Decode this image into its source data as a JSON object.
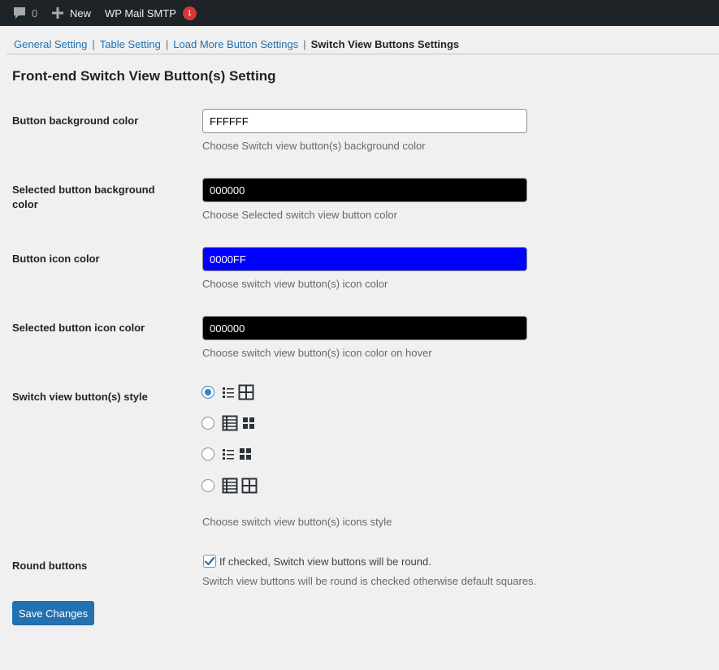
{
  "adminbar": {
    "comments_count": "0",
    "new_label": "New",
    "smtp_label": "WP Mail SMTP",
    "smtp_badge": "1"
  },
  "nav": {
    "tabs": [
      {
        "label": "General Setting"
      },
      {
        "label": "Table Setting"
      },
      {
        "label": "Load More Button Settings"
      },
      {
        "label": "Switch View Buttons Settings",
        "current": true
      }
    ],
    "separator": "|"
  },
  "page": {
    "heading": "Front-end Switch View Button(s) Setting"
  },
  "fields": {
    "button_bg": {
      "label": "Button background color",
      "value": "FFFFFF",
      "bg_color": "#FFFFFF",
      "text_color": "#000000",
      "description": "Choose Switch view button(s) background color"
    },
    "selected_button_bg": {
      "label": "Selected button background color",
      "value": "000000",
      "bg_color": "#000000",
      "text_color": "#FFFFFF",
      "description": "Choose Selected switch view button color"
    },
    "button_icon": {
      "label": "Button icon color",
      "value": "0000FF",
      "bg_color": "#0000FF",
      "text_color": "#FFFFFF",
      "description": "Choose switch view button(s) icon color"
    },
    "selected_button_icon": {
      "label": "Selected button icon color",
      "value": "000000",
      "bg_color": "#000000",
      "text_color": "#FFFFFF",
      "description": "Choose switch view button(s) icon color on hover"
    },
    "style": {
      "label": "Switch view button(s) style",
      "options": [
        {
          "icons": [
            "list-dots-icon",
            "grid-outline-icon"
          ],
          "checked": true
        },
        {
          "icons": [
            "list-table-icon",
            "grid-filled-icon"
          ],
          "checked": false
        },
        {
          "icons": [
            "list-dots-icon",
            "grid-filled-icon"
          ],
          "checked": false
        },
        {
          "icons": [
            "list-table-icon",
            "grid-outline-icon"
          ],
          "checked": false
        }
      ],
      "description": "Choose switch view button(s) icons style"
    },
    "round": {
      "label": "Round buttons",
      "checked": true,
      "checkbox_label": "If checked, Switch view buttons will be round.",
      "description": "Switch view buttons will be round is checked otherwise default squares."
    }
  },
  "actions": {
    "save_label": "Save Changes"
  },
  "colors": {
    "primary": "#2271b1",
    "radio_checked": "#3582c4",
    "adminbar_bg": "#1d2327",
    "badge": "#d63638"
  }
}
